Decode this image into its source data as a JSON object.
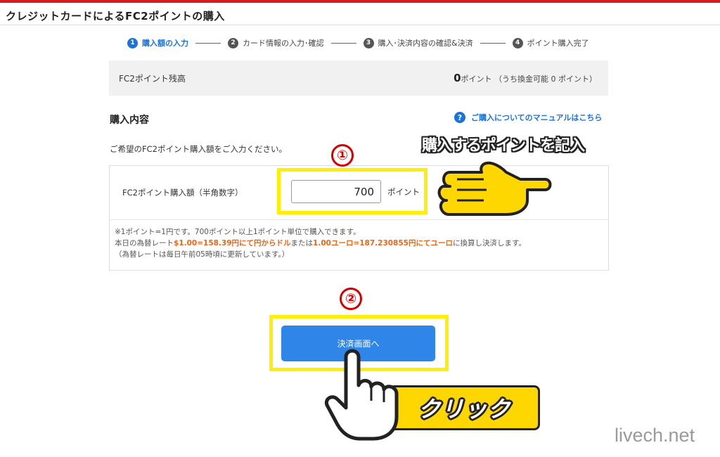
{
  "page": {
    "title": "クレジットカードによるFC2ポイントの購入",
    "watermark": "livech.net"
  },
  "steps": [
    {
      "num": "1",
      "label": "購入額の入力",
      "active": true
    },
    {
      "num": "2",
      "label": "カード情報の入力･確認",
      "active": false
    },
    {
      "num": "3",
      "label": "購入･決済内容の確認&決済",
      "active": false
    },
    {
      "num": "4",
      "label": "ポイント購入完了",
      "active": false
    }
  ],
  "balance": {
    "label": "FC2ポイント残高",
    "value": "0",
    "unit": "ポイント",
    "exchangeable": "（うち換金可能 0 ポイント）"
  },
  "purchase": {
    "section_title": "購入内容",
    "manual_link": "ご購入についてのマニュアルはこちら",
    "instruction": "ご希望のFC2ポイント購入額をご入力ください。",
    "amount_label": "FC2ポイント購入額（半角数字）",
    "amount_value": "700",
    "amount_unit": "ポイント",
    "note1": "※1ポイント=1円です。700ポイント以上1ポイント単位で購入できます。",
    "note2_prefix": "本日の為替レート",
    "note2_rate_usd": "$1.00=158.39円にて円からドル",
    "note2_mid": "または",
    "note2_rate_eur": "1.00ユーロ=187.230855円にてユーロ",
    "note2_suffix": "に換算し決済します。",
    "note3": "（為替レートは毎日午前05時頃に更新しています。）",
    "submit_label": "決済画面へ"
  },
  "annotations": {
    "marker1": "①",
    "marker2": "②",
    "callout": "購入するポイントを記入",
    "click_label": "クリック"
  },
  "icons": {
    "help": "question-circle-icon",
    "pointing_hand": "pointing-hand-icon",
    "tapping_hand": "tapping-hand-icon"
  },
  "colors": {
    "brand_red": "#d71a1a",
    "accent_blue": "#1a73d9",
    "button_blue": "#2f86e8",
    "rate_orange": "#e8671a",
    "highlight_yellow": "#ffef00",
    "marker_red": "#d40000"
  }
}
